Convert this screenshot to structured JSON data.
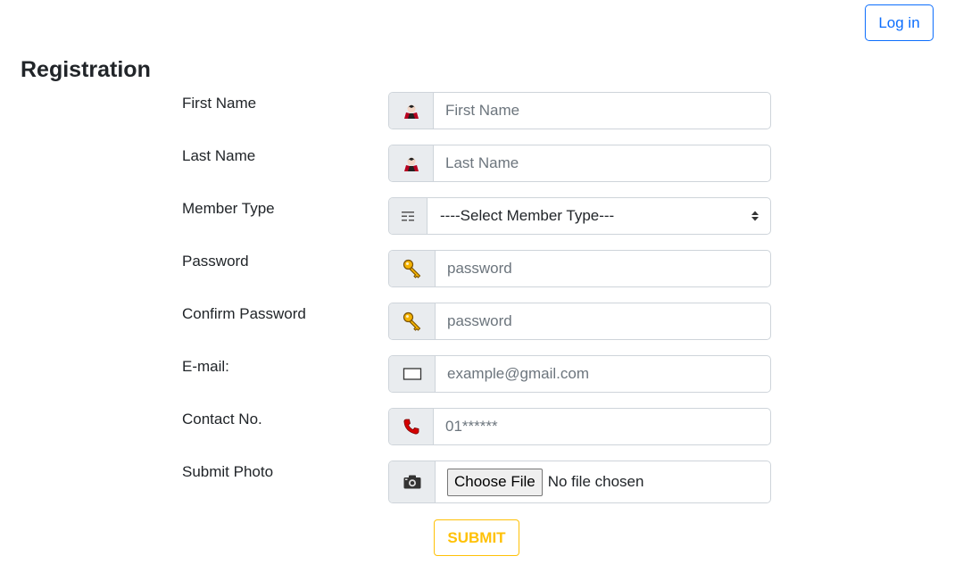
{
  "header": {
    "login_label": "Log in"
  },
  "page": {
    "title": "Registration"
  },
  "form": {
    "first_name": {
      "label": "First Name",
      "placeholder": "First Name",
      "icon": "person-icon"
    },
    "last_name": {
      "label": "Last Name",
      "placeholder": "Last Name",
      "icon": "person-icon"
    },
    "member_type": {
      "label": "Member Type",
      "selected": "----Select Member Type---",
      "icon": "list-icon"
    },
    "password": {
      "label": "Password",
      "placeholder": "password",
      "icon": "key-icon"
    },
    "confirm_password": {
      "label": "Confirm Password",
      "placeholder": "password",
      "icon": "key-icon"
    },
    "email": {
      "label": "E-mail:",
      "placeholder": "example@gmail.com",
      "icon": "envelope-icon"
    },
    "contact": {
      "label": "Contact No.",
      "placeholder": "01******",
      "icon": "phone-icon"
    },
    "photo": {
      "label": "Submit Photo",
      "choose_label": "Choose File",
      "status": "No file chosen",
      "icon": "camera-icon"
    },
    "submit_label": "SUBMIT"
  },
  "colors": {
    "primary": "#0d6efd",
    "warning": "#ffc107",
    "addon_bg": "#e9ecef",
    "border": "#ced4da"
  }
}
